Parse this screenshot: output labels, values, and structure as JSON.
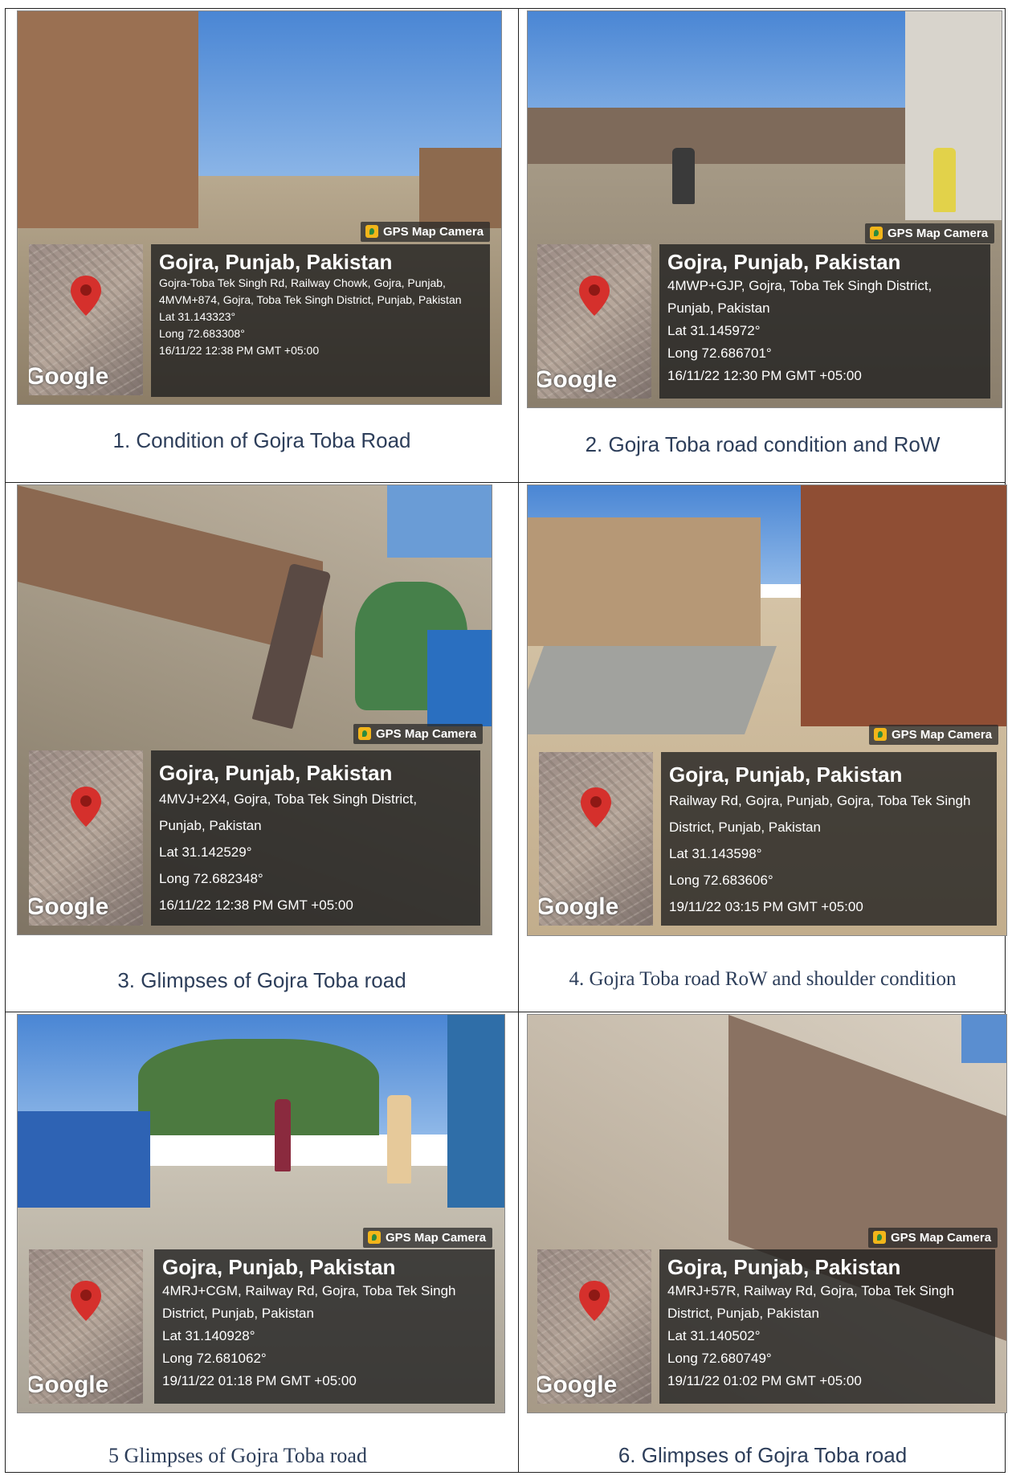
{
  "gps_label": "GPS Map Camera",
  "map_brand": "Google",
  "photos": [
    {
      "place": "Gojra, Punjab, Pakistan",
      "address_lines": [
        "Gojra-Toba Tek Singh Rd, Railway Chowk, Gojra, Punjab,",
        "4MVM+874, Gojra, Toba Tek Singh District, Punjab, Pakistan"
      ],
      "lat": "Lat 31.143323°",
      "long": "Long 72.683308°",
      "datetime": "16/11/22 12:38 PM GMT +05:00",
      "caption": "1. Condition of Gojra Toba Road"
    },
    {
      "place": "Gojra, Punjab, Pakistan",
      "address_lines": [
        "4MWP+GJP, Gojra, Toba Tek Singh District,",
        "Punjab, Pakistan"
      ],
      "lat": "Lat 31.145972°",
      "long": "Long 72.686701°",
      "datetime": "16/11/22 12:30 PM GMT +05:00",
      "caption": "2. Gojra Toba road condition and RoW"
    },
    {
      "place": "Gojra, Punjab, Pakistan",
      "address_lines": [
        "4MVJ+2X4, Gojra, Toba Tek Singh District,",
        "Punjab, Pakistan"
      ],
      "lat": "Lat 31.142529°",
      "long": "Long 72.682348°",
      "datetime": "16/11/22 12:38 PM GMT +05:00",
      "caption": "3. Glimpses of Gojra Toba road"
    },
    {
      "place": "Gojra, Punjab, Pakistan",
      "address_lines": [
        "Railway Rd, Gojra, Punjab, Gojra, Toba Tek Singh",
        "District, Punjab, Pakistan"
      ],
      "lat": "Lat 31.143598°",
      "long": "Long 72.683606°",
      "datetime": "19/11/22 03:15 PM GMT +05:00",
      "caption": "4. Gojra Toba road RoW and shoulder condition"
    },
    {
      "place": "Gojra, Punjab, Pakistan",
      "address_lines": [
        "4MRJ+CGM, Railway Rd, Gojra, Toba Tek Singh",
        "District, Punjab, Pakistan"
      ],
      "lat": "Lat 31.140928°",
      "long": "Long 72.681062°",
      "datetime": "19/11/22 01:18 PM GMT +05:00",
      "caption": "5 Glimpses of Gojra Toba road"
    },
    {
      "place": "Gojra, Punjab, Pakistan",
      "address_lines": [
        "4MRJ+57R, Railway Rd, Gojra, Toba Tek Singh",
        "District, Punjab, Pakistan"
      ],
      "lat": "Lat 31.140502°",
      "long": "Long 72.680749°",
      "datetime": "19/11/22 01:02 PM GMT +05:00",
      "caption": "6. Glimpses of Gojra Toba road"
    }
  ]
}
